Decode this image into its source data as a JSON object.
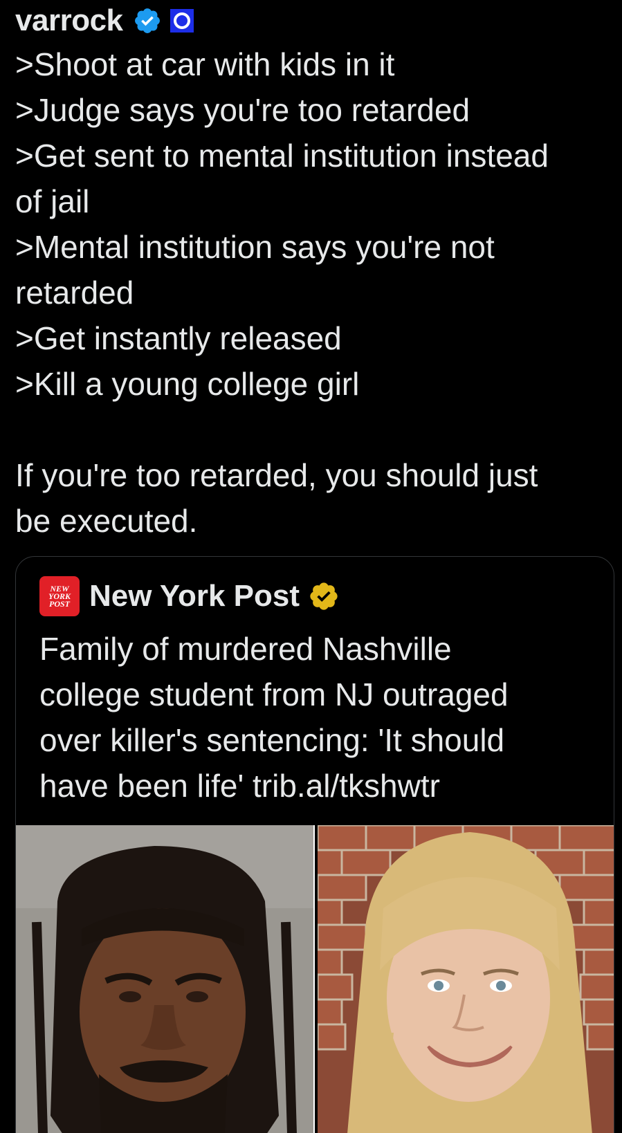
{
  "post": {
    "username": "varrock",
    "lines": [
      ">Shoot at car with kids in it",
      ">Judge says you're too retarded",
      ">Get sent to mental institution instead",
      "of jail",
      ">Mental institution says you're not",
      "retarded",
      ">Get instantly released",
      ">Kill a young college girl",
      "If you're too retarded, you should just",
      "be executed."
    ]
  },
  "quote": {
    "logo_text": "NEW YORK POST",
    "name": "New York Post",
    "text_lines": [
      "Family of murdered Nashville",
      "college student from NJ outraged",
      "over killer's sentencing: 'It should",
      "have been life' trib.al/tkshwtr"
    ]
  },
  "icons": {
    "verified": "verified-badge-icon",
    "affiliate": "affiliate-badge-icon",
    "gold": "gold-verified-badge-icon"
  },
  "colors": {
    "background": "#000000",
    "text": "#e7e9ea",
    "verified_blue": "#1d9bf0",
    "gold": "#e2b719",
    "nyp_red": "#e12027"
  }
}
